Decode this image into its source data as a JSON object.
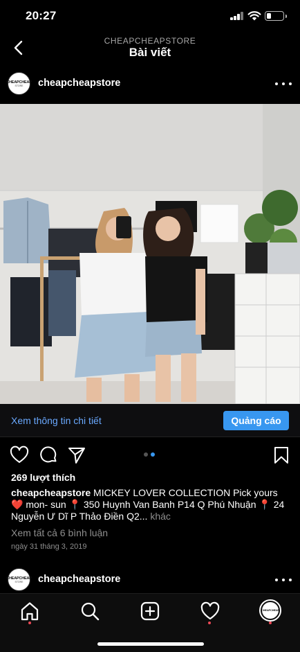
{
  "status_bar": {
    "time": "20:27",
    "battery_percent": 30
  },
  "header": {
    "subtitle": "CHEAPCHEAPSTORE",
    "title": "Bài viết"
  },
  "post": {
    "avatar_text_line1": "CHEAPCHEAP",
    "avatar_text_line2": "STORE",
    "username": "cheapcheapstore",
    "cta_link": "Xem thông tin chi tiết",
    "cta_button": "Quảng cáo",
    "carousel": {
      "count": 2,
      "active_index": 1
    },
    "likes": "269 lượt thích",
    "caption_user": "cheapcheapstore",
    "caption_text": " MICKEY LOVER COLLECTION Pick yours ❤️ mon- sun 📍 350 Huynh Van Banh P14 Q Phú Nhuận 📍 24 Nguyễn Ư Dĩ P Thảo Điền Q2...",
    "caption_more": " khác",
    "comments_link": "Xem tất cả 6 bình luận",
    "date": "ngày 31 tháng 3, 2019"
  },
  "next_post": {
    "username": "cheapcheapstore"
  },
  "icons": {
    "back": "chevron-left-icon",
    "more": "more-horizontal-icon",
    "like": "heart-icon",
    "comment": "comment-icon",
    "share": "send-icon",
    "save": "bookmark-icon",
    "tab_home": "home-icon",
    "tab_search": "search-icon",
    "tab_new": "add-post-icon",
    "tab_activity": "heart-icon",
    "tab_profile": "profile-avatar"
  },
  "colors": {
    "accent": "#3897f0",
    "link": "#6aa9ff",
    "notification": "#ed4956",
    "muted": "#8e8e8e"
  }
}
